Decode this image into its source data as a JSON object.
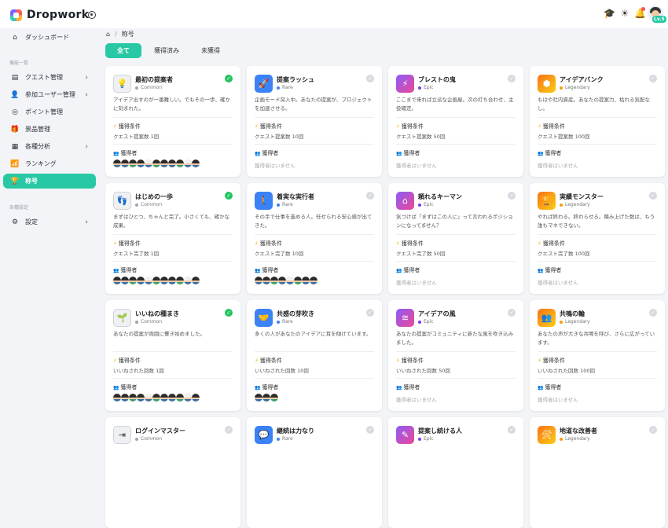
{
  "app": {
    "name": "Dropwork",
    "level": "Lv.5"
  },
  "breadcrumb": {
    "current": "称号"
  },
  "nav": {
    "dashboard": "ダッシュボード",
    "section_features": "機能一覧",
    "items": [
      {
        "label": "クエスト管理",
        "chev": true
      },
      {
        "label": "参加ユーザー管理",
        "chev": true
      },
      {
        "label": "ポイント管理",
        "chev": false
      },
      {
        "label": "景品管理",
        "chev": false
      },
      {
        "label": "各種分析",
        "chev": true
      },
      {
        "label": "ランキング",
        "chev": false
      },
      {
        "label": "称号",
        "chev": false
      }
    ],
    "section_settings": "各種設定",
    "settings": "設定"
  },
  "tabs": [
    "全て",
    "獲得済み",
    "未獲得"
  ],
  "labels": {
    "condition": "獲得条件",
    "achievers": "獲得者",
    "none": "獲得者はいません"
  },
  "colors": {
    "accent": "#28c8a4",
    "common": "#a0a6ad",
    "rare": "#3b82f6",
    "epic": "#7c3aed",
    "legendary": "#f59e0b"
  },
  "cards": [
    {
      "name": "最初の提案者",
      "rarity": "Common",
      "icon": "lightbulb-icon",
      "glyph": "💡",
      "acquired": true,
      "desc": "アイデア出すのが一番難しい。でもその一歩、確かに刻まれた。",
      "cond": "クエスト提案数 1回",
      "faces": 11
    },
    {
      "name": "提案ラッシュ",
      "rarity": "Rare",
      "icon": "rocket-icon",
      "glyph": "🚀",
      "acquired": false,
      "desc": "企画モード突入中。あなたの提案が、プロジェクトを加速させる。",
      "cond": "クエスト提案数 10回",
      "faces": 0
    },
    {
      "name": "ブレストの鬼",
      "rarity": "Epic",
      "icon": "lightning-icon",
      "glyph": "⚡",
      "acquired": false,
      "desc": "ここまで来れば立派な企画屋。次の打ち合わせ、主役確定。",
      "cond": "クエスト提案数 50回",
      "faces": 0
    },
    {
      "name": "アイデアバンク",
      "rarity": "Legendary",
      "icon": "bank-icon",
      "glyph": "⬢",
      "acquired": false,
      "desc": "もはや社内資産。あなたの提案力、枯れる気配なし。",
      "cond": "クエスト提案数 100回",
      "faces": 0
    },
    {
      "name": "はじめの一歩",
      "rarity": "Common",
      "icon": "footsteps-icon",
      "glyph": "👣",
      "acquired": true,
      "desc": "まずはひとつ、ちゃんと完了。小さくても、確かな成果。",
      "cond": "クエスト完了数 1回",
      "faces": 11
    },
    {
      "name": "着実な実行者",
      "rarity": "Rare",
      "icon": "walker-icon",
      "glyph": "🚶",
      "acquired": false,
      "desc": "その手で仕事を進める人。任せられる安心感が出てきた。",
      "cond": "クエスト完了数 10回",
      "faces": 8
    },
    {
      "name": "頼れるキーマン",
      "rarity": "Epic",
      "icon": "home-icon",
      "glyph": "⌂",
      "acquired": false,
      "desc": "気づけば「まずはこの人に」って言われるポジションになってません？",
      "cond": "クエスト完了数 50回",
      "faces": 0
    },
    {
      "name": "実績モンスター",
      "rarity": "Legendary",
      "icon": "trophy-icon",
      "glyph": "🏆",
      "acquired": false,
      "desc": "やれば終わる。終わらせる。積み上げた数は、もう誰もマネできない。",
      "cond": "クエスト完了数 100回",
      "faces": 0
    },
    {
      "name": "いいねの種まき",
      "rarity": "Common",
      "icon": "sprout-icon",
      "glyph": "🌱",
      "acquired": true,
      "desc": "あなたの提案が周囲に響き始めました。",
      "cond": "いいねされた回数 1回",
      "faces": 11
    },
    {
      "name": "共感の芽吹き",
      "rarity": "Rare",
      "icon": "handshake-icon",
      "glyph": "🤝",
      "acquired": false,
      "desc": "多くの人があなたのアイデアに耳を傾けています。",
      "cond": "いいねされた回数 10回",
      "faces": 3
    },
    {
      "name": "アイデアの風",
      "rarity": "Epic",
      "icon": "wind-icon",
      "glyph": "≋",
      "acquired": false,
      "desc": "あなたの提案がコミュニティに新たな風を吹き込みました。",
      "cond": "いいねされた回数 50回",
      "faces": 0
    },
    {
      "name": "共鳴の輪",
      "rarity": "Legendary",
      "icon": "people-circle-icon",
      "glyph": "👥",
      "acquired": false,
      "desc": "あなたの声が大きな共鳴を呼び、さらに広がっています。",
      "cond": "いいねされた回数 100回",
      "faces": 0
    },
    {
      "name": "ログインマスター",
      "rarity": "Common",
      "icon": "login-icon",
      "glyph": "⇥",
      "acquired": false,
      "desc": "",
      "cond": "",
      "faces": 0
    },
    {
      "name": "継続は力なり",
      "rarity": "Rare",
      "icon": "chat-icon",
      "glyph": "💬",
      "acquired": false,
      "desc": "",
      "cond": "",
      "faces": 0
    },
    {
      "name": "提案し続ける人",
      "rarity": "Epic",
      "icon": "edit-icon",
      "glyph": "✎",
      "acquired": false,
      "desc": "",
      "cond": "",
      "faces": 0
    },
    {
      "name": "地道な改善者",
      "rarity": "Legendary",
      "icon": "tools-icon",
      "glyph": "🛠",
      "acquired": false,
      "desc": "",
      "cond": "",
      "faces": 0
    }
  ]
}
